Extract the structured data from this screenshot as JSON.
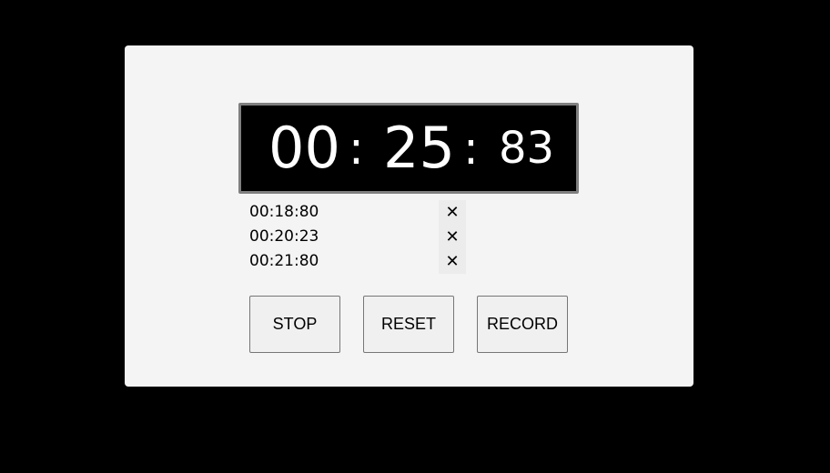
{
  "timer": {
    "minutes": "00",
    "separator": ":",
    "seconds": "25",
    "centiseconds": "83"
  },
  "laps": [
    {
      "time": "00:18:80",
      "delete_symbol": "✕"
    },
    {
      "time": "00:20:23",
      "delete_symbol": "✕"
    },
    {
      "time": "00:21:80",
      "delete_symbol": "✕"
    }
  ],
  "buttons": {
    "stop_label": "STOP",
    "reset_label": "RESET",
    "record_label": "RECORD"
  },
  "colors": {
    "page_background": "#000000",
    "card_background": "#f4f4f4",
    "display_background": "#000000",
    "display_border": "#7f7f7f",
    "display_text": "#ffffff"
  }
}
